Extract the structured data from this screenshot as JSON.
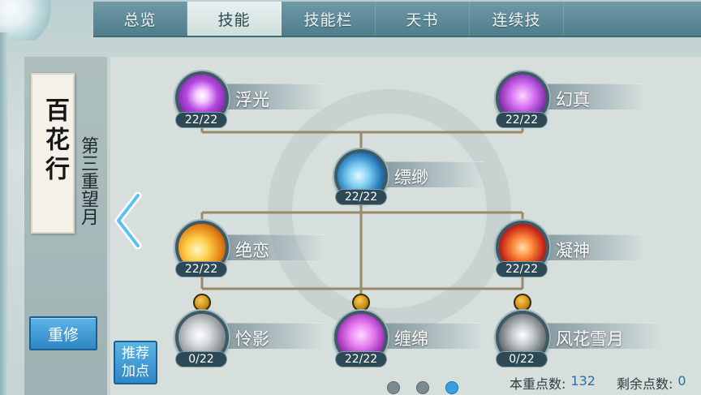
{
  "tabs": [
    {
      "label": "总览",
      "active": false
    },
    {
      "label": "技能",
      "active": true
    },
    {
      "label": "技能栏",
      "active": false
    },
    {
      "label": "天书",
      "active": false
    },
    {
      "label": "连续技",
      "active": false
    }
  ],
  "school": {
    "name": "百花行",
    "realm": "第三重望月"
  },
  "buttons": {
    "retrain": "重修",
    "recommend_line1": "推荐",
    "recommend_line2": "加点"
  },
  "skills": [
    {
      "name": "浮光",
      "level": "22/22",
      "icon": "radiant-burst-icon",
      "color": "#a53ed6"
    },
    {
      "name": "幻真",
      "level": "22/22",
      "icon": "butterfly-swarm-icon",
      "color": "#b04fe0"
    },
    {
      "name": "缥缈",
      "level": "22/22",
      "icon": "wind-wave-icon",
      "color": "#2d8fd1"
    },
    {
      "name": "绝恋",
      "level": "22/22",
      "icon": "golden-flare-icon",
      "color": "#e6951e"
    },
    {
      "name": "凝神",
      "level": "22/22",
      "icon": "crimson-blade-icon",
      "color": "#e0502a"
    },
    {
      "name": "怜影",
      "level": "0/22",
      "icon": "grey-swirl-icon",
      "color": "#9aa0a3"
    },
    {
      "name": "缠绵",
      "level": "22/22",
      "icon": "violet-strands-icon",
      "color": "#d054d6"
    },
    {
      "name": "风花雪月",
      "level": "0/22",
      "icon": "moon-blossom-icon",
      "color": "#8a9092"
    }
  ],
  "stats": {
    "current_points_label": "本重点数:",
    "current_points_value": "132",
    "remaining_points_label": "剩余点数:",
    "remaining_points_value": "0"
  },
  "pager": {
    "total": 3,
    "active_index": 2
  }
}
